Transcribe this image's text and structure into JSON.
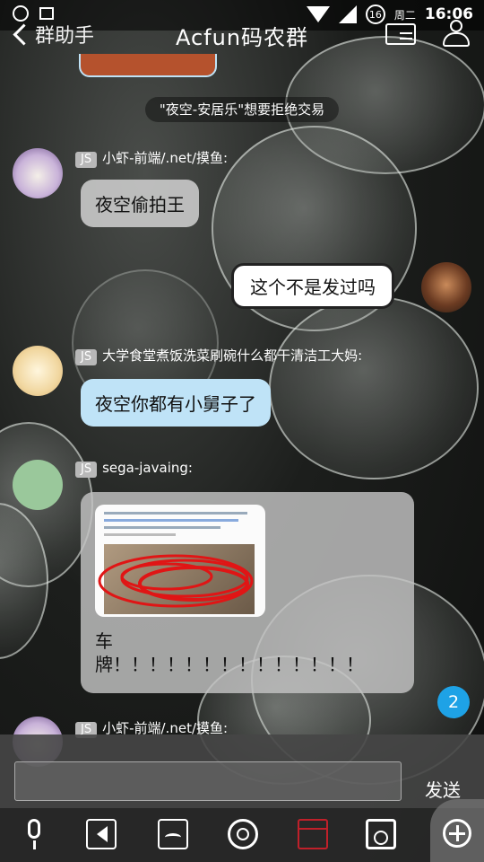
{
  "status": {
    "time": "16:06",
    "weekday": "周二",
    "badge": "16"
  },
  "header": {
    "back_label": "群助手",
    "title": "Acfun码农群"
  },
  "system_message": "\"夜空-安居乐\"想要拒绝交易",
  "messages": [
    {
      "tag": "JS",
      "sender": "小虾-前端/.net/摸鱼:",
      "text": "夜空偷拍王"
    },
    {
      "text": "这个不是发过吗"
    },
    {
      "tag": "JS",
      "sender": "大学食堂煮饭洗菜刷碗什么都干清洁工大妈:",
      "text": "夜空你都有小舅子了"
    },
    {
      "tag": "JS",
      "sender": "sega-javaing:",
      "text_line1": "车",
      "text_line2": "牌！！！！！！！！！！！！！！"
    },
    {
      "tag": "JS",
      "sender": "小虾-前端/.net/摸鱼:"
    }
  ],
  "unread_count": "2",
  "input": {
    "send_label": "发送",
    "placeholder": ""
  },
  "toolbar": {
    "icons": [
      "voice-icon",
      "video-icon",
      "image-icon",
      "camera-icon",
      "red-packet-icon",
      "record-icon",
      "emoji-plus-icon"
    ]
  },
  "colors": {
    "blue_bubble": "#bfe3f7",
    "unread": "#1ea2e6",
    "red_packet": "#c0202a"
  }
}
